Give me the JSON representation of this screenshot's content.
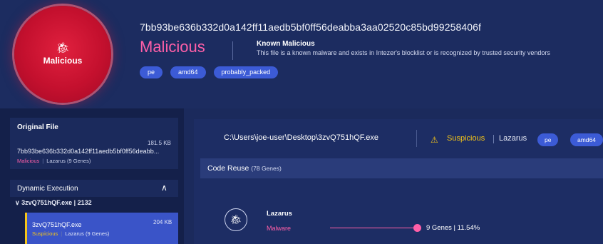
{
  "header": {
    "verdict_label": "Malicious",
    "hash": "7bb93be636b332d0a142ff11aedb5bf0ff56deabba3aa02520c85bd99258406f",
    "verdict": "Malicious",
    "known_title": "Known Malicious",
    "known_desc": "This file is a known malware and exists in Intezer's blocklist or is recognized by trusted security vendors",
    "tags": [
      "pe",
      "amd64",
      "probably_packed"
    ]
  },
  "sidebar": {
    "original_file": {
      "heading": "Original File",
      "size": "181.5 KB",
      "name": "7bb93be636b332d0a142ff11aedb5bf0ff56deabb...",
      "verdict": "Malicious",
      "family": "Lazarus (9 Genes)"
    },
    "dynamic": {
      "heading": "Dynamic Execution",
      "process_line": "∨ 3zvQ751hQF.exe | 2132",
      "process": {
        "name": "3zvQ751hQF.exe",
        "size": "204 KB",
        "verdict": "Suspicious",
        "family": "Lazarus (9 Genes)"
      }
    }
  },
  "main": {
    "file_path": "C:\\Users\\joe-user\\Desktop\\3zvQ751hQF.exe",
    "verdict": "Suspicious",
    "family": "Lazarus",
    "tags": [
      "pe",
      "amd64"
    ],
    "code_reuse_title": "Code Reuse",
    "code_reuse_count": "(78 Genes)",
    "family_entry": {
      "name": "Lazarus",
      "type": "Malware",
      "genes": "9 Genes | 11.54%"
    }
  },
  "colors": {
    "malicious": "#ff5fa8",
    "suspicious": "#f5c518",
    "accent": "#3c5bd6",
    "background": "#1b2a5c"
  },
  "icons": {
    "verdict": "bug-icon",
    "warning": "warning-icon",
    "family": "bug-icon",
    "collapse": "chevron-up-icon"
  }
}
